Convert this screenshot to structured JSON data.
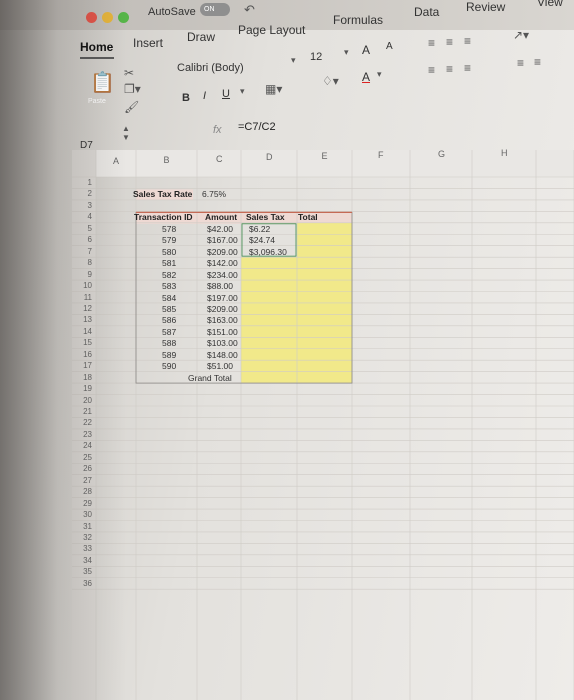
{
  "titlebar": {
    "autosave_label": "AutoSave",
    "toggle_label": "ON",
    "traffic_colors": [
      "#e4554a",
      "#e6b53c",
      "#56b548"
    ]
  },
  "tabs": [
    "Home",
    "Insert",
    "Draw",
    "Page Layout",
    "Formulas",
    "Data",
    "Review",
    "View"
  ],
  "ribbon": {
    "paste_label": "Paste",
    "font_name": "Calibri (Body)",
    "font_size": "12",
    "bold": "B",
    "italic": "I",
    "underline": "U",
    "grow_font": "A",
    "shrink_font": "A",
    "font_color": "A"
  },
  "formula_bar": {
    "cell_ref": "D7",
    "fx": "fx",
    "formula": "=C7/C2"
  },
  "columns": [
    "A",
    "B",
    "C",
    "D",
    "E",
    "F",
    "G",
    "H"
  ],
  "rows": [
    "1",
    "2",
    "3",
    "4",
    "5",
    "6",
    "7",
    "8",
    "9",
    "10",
    "11",
    "12",
    "13",
    "14",
    "15",
    "16",
    "17",
    "18",
    "19",
    "20",
    "21",
    "22",
    "23",
    "24",
    "25",
    "26",
    "27",
    "28",
    "29",
    "30",
    "31",
    "32",
    "33",
    "34",
    "35",
    "36"
  ],
  "sheet": {
    "rate_label": "Sales Tax Rate",
    "rate_value": "6.75%",
    "headers": [
      "Transaction ID",
      "Amount",
      "Sales Tax",
      "Total"
    ],
    "table": [
      {
        "id": "578",
        "amount": "$42.00",
        "tax": "$6.22"
      },
      {
        "id": "579",
        "amount": "$167.00",
        "tax": "$24.74"
      },
      {
        "id": "580",
        "amount": "$209.00",
        "tax": "$3,096.30"
      },
      {
        "id": "581",
        "amount": "$142.00",
        "tax": ""
      },
      {
        "id": "582",
        "amount": "$234.00",
        "tax": ""
      },
      {
        "id": "583",
        "amount": "$88.00",
        "tax": ""
      },
      {
        "id": "584",
        "amount": "$197.00",
        "tax": ""
      },
      {
        "id": "585",
        "amount": "$209.00",
        "tax": ""
      },
      {
        "id": "586",
        "amount": "$163.00",
        "tax": ""
      },
      {
        "id": "587",
        "amount": "$151.00",
        "tax": ""
      },
      {
        "id": "588",
        "amount": "$103.00",
        "tax": ""
      },
      {
        "id": "589",
        "amount": "$148.00",
        "tax": ""
      },
      {
        "id": "590",
        "amount": "$51.00",
        "tax": ""
      }
    ],
    "grand_total_label": "Grand Total"
  },
  "colors": {
    "header_fill": "#eed9d3",
    "yellow_fill": "#f1e98a",
    "header_border": "#c56a55"
  }
}
